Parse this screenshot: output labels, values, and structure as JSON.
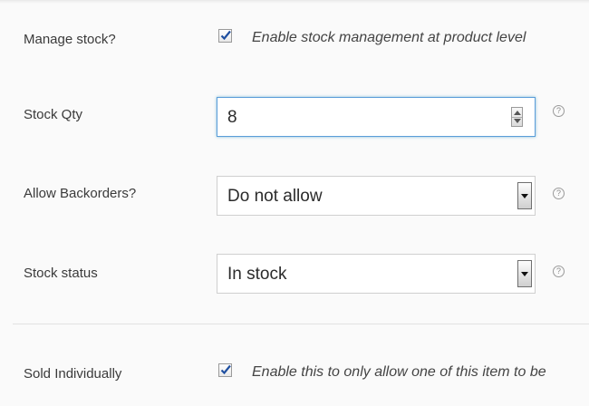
{
  "manage_stock": {
    "label": "Manage stock?",
    "checked": true,
    "description": "Enable stock management at product level"
  },
  "stock_qty": {
    "label": "Stock Qty",
    "value": "8",
    "help_icon": "question-circle"
  },
  "backorders": {
    "label": "Allow Backorders?",
    "selected": "Do not allow",
    "help_icon": "question-circle"
  },
  "stock_status": {
    "label": "Stock status",
    "selected": "In stock",
    "help_icon": "question-circle"
  },
  "sold_individually": {
    "label": "Sold Individually",
    "checked": true,
    "description": "Enable this to only allow one of this item to be"
  },
  "colors": {
    "focus_border": "#5b9dd9",
    "panel_bg": "#fafafa"
  }
}
